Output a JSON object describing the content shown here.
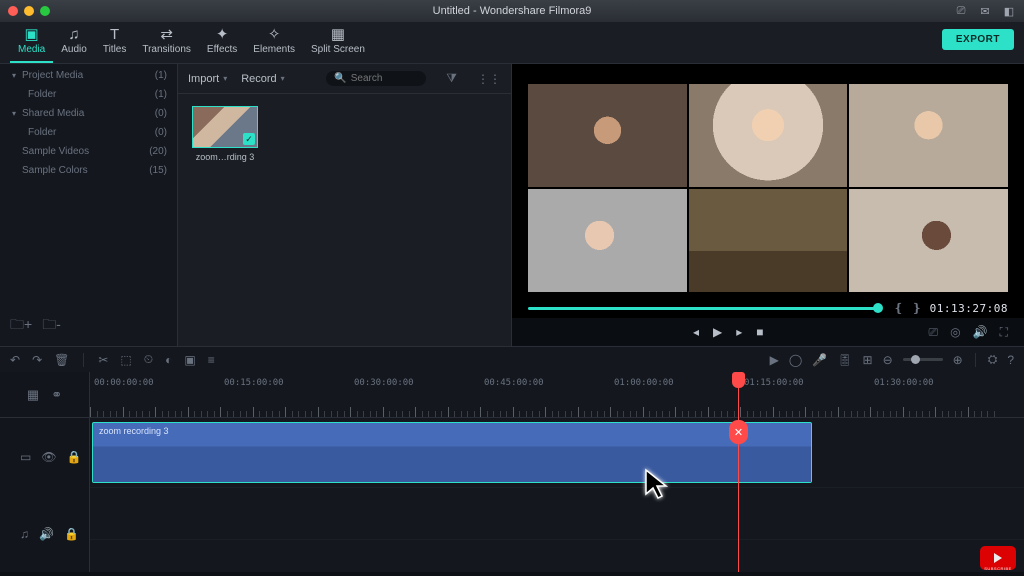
{
  "titlebar": {
    "title": "Untitled - Wondershare Filmora9"
  },
  "tabs": [
    {
      "label": "Media",
      "active": true
    },
    {
      "label": "Audio"
    },
    {
      "label": "Titles"
    },
    {
      "label": "Transitions"
    },
    {
      "label": "Effects"
    },
    {
      "label": "Elements"
    },
    {
      "label": "Split Screen"
    }
  ],
  "export_label": "EXPORT",
  "media_tree": [
    {
      "label": "Project Media",
      "count": "(1)",
      "expandable": true,
      "open": true
    },
    {
      "label": "Folder",
      "count": "(1)",
      "child": true
    },
    {
      "label": "Shared Media",
      "count": "(0)",
      "expandable": true,
      "open": true
    },
    {
      "label": "Folder",
      "count": "(0)",
      "child": true
    },
    {
      "label": "Sample Videos",
      "count": "(20)"
    },
    {
      "label": "Sample Colors",
      "count": "(15)"
    }
  ],
  "browser": {
    "import": "Import",
    "record": "Record",
    "search_placeholder": "Search",
    "thumb": {
      "caption": "zoom…rding 3"
    }
  },
  "preview": {
    "timecode": "01:13:27:08"
  },
  "ruler_labels": [
    "00:00:00:00",
    "00:15:00:00",
    "00:30:00:00",
    "00:45:00:00",
    "01:00:00:00",
    "01:15:00:00",
    "01:30:00:00"
  ],
  "clip": {
    "label": "zoom recording 3"
  },
  "yt": {
    "subscribe": "SUBSCRIBE"
  }
}
